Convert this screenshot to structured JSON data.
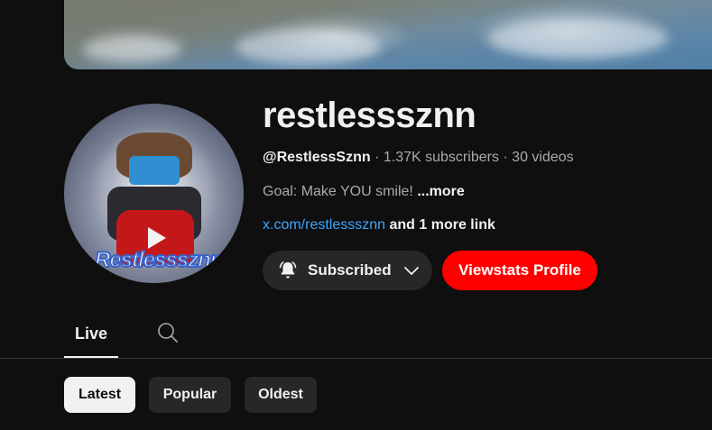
{
  "channel": {
    "name": "restlesssznn",
    "handle": "@RestlessSznn",
    "separator": "·",
    "subscribers": "1.37K subscribers",
    "videos": "30 videos",
    "description": "Goal: Make YOU smile!",
    "description_more": "...more",
    "link_text": "x.com/restlesssznn",
    "more_links": "and 1 more link",
    "avatar_text": "Restlesssznn"
  },
  "buttons": {
    "subscribed_label": "Subscribed",
    "viewstats_label": "Viewstats Profile"
  },
  "tabs": [
    {
      "label": "Live",
      "selected": true
    }
  ],
  "chips": [
    {
      "label": "Latest",
      "selected": true
    },
    {
      "label": "Popular",
      "selected": false
    },
    {
      "label": "Oldest",
      "selected": false
    }
  ],
  "icons": {
    "bell": "bell-ringing-icon",
    "chevron": "chevron-down-icon",
    "search": "search-icon"
  },
  "colors": {
    "background": "#0f0f0f",
    "accent_red": "#ff0000",
    "link_blue": "#3ea6ff",
    "chip_selected": "#f1f1f1",
    "chip_default": "#272727"
  }
}
